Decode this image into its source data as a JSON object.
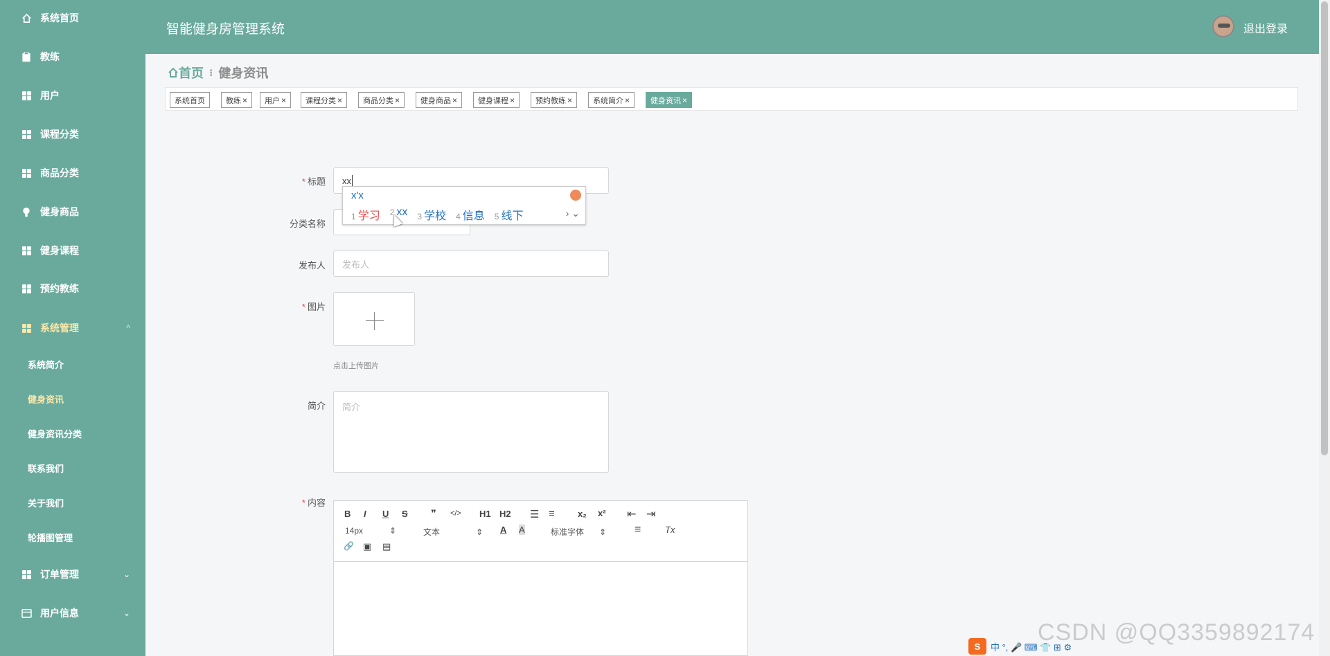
{
  "sidebar": {
    "items": [
      {
        "label": "系统首页",
        "icon": "home-icon"
      },
      {
        "label": "教练",
        "icon": "clipboard-icon"
      },
      {
        "label": "用户",
        "icon": "grid-icon"
      },
      {
        "label": "课程分类",
        "icon": "grid-icon"
      },
      {
        "label": "商品分类",
        "icon": "grid-icon"
      },
      {
        "label": "健身商品",
        "icon": "bulb-icon"
      },
      {
        "label": "健身课程",
        "icon": "grid-icon"
      },
      {
        "label": "预约教练",
        "icon": "grid-icon"
      },
      {
        "label": "系统管理",
        "icon": "grid-icon"
      },
      {
        "label": "订单管理",
        "icon": "grid-icon"
      },
      {
        "label": "用户信息",
        "icon": "card-icon"
      }
    ],
    "sub_items": [
      "系统简介",
      "健身资讯",
      "健身资讯分类",
      "联系我们",
      "关于我们",
      "轮播图管理"
    ],
    "active_sub": "健身资讯",
    "chevron_up": "^",
    "chevron_down": "⌄"
  },
  "header": {
    "title": "智能健身房管理系统",
    "logout": "退出登录"
  },
  "breadcrumb": {
    "home": "首页",
    "separator": "⁝",
    "current": "健身资讯"
  },
  "tabs": [
    {
      "label": "系统首页",
      "closable": false
    },
    {
      "label": "教练",
      "closable": true
    },
    {
      "label": "用户",
      "closable": true
    },
    {
      "label": "课程分类",
      "closable": true
    },
    {
      "label": "商品分类",
      "closable": true
    },
    {
      "label": "健身商品",
      "closable": true
    },
    {
      "label": "健身课程",
      "closable": true
    },
    {
      "label": "预约教练",
      "closable": true
    },
    {
      "label": "系统简介",
      "closable": true
    },
    {
      "label": "健身资讯",
      "closable": true,
      "active": true
    }
  ],
  "tab_close": "×",
  "form": {
    "title_label": "标题",
    "title_value": "xx",
    "category_label": "分类名称",
    "publisher_label": "发布人",
    "publisher_placeholder": "发布人",
    "image_label": "图片",
    "upload_hint": "点击上传图片",
    "intro_label": "简介",
    "intro_placeholder": "简介",
    "content_label": "内容",
    "required_mark": "*"
  },
  "editor": {
    "bold": "B",
    "italic": "I",
    "underline": "U",
    "strike": "S",
    "quote": "❞",
    "code": "</>",
    "h1": "H1",
    "h2": "H2",
    "ordered_list": "☰",
    "bullet_list": "≡",
    "subscript": "x₂",
    "superscript": "x²",
    "outdent": "⇤",
    "indent": "⇥",
    "font_size": "14px",
    "text_style": "文本",
    "font_family": "标准字体",
    "font_color": "A",
    "bg_color": "A",
    "align": "≡",
    "clear": "Tx",
    "link": "🔗",
    "image": "▣",
    "video": "▤"
  },
  "ime": {
    "composition": "x'x",
    "candidates": [
      {
        "num": "1",
        "text": "学习"
      },
      {
        "num": "2",
        "text": "xx"
      },
      {
        "num": "3",
        "text": "学校"
      },
      {
        "num": "4",
        "text": "信息"
      },
      {
        "num": "5",
        "text": "线下"
      }
    ],
    "nav": "› ⌄"
  },
  "tray": {
    "logo": "S",
    "items": "中 °, 🎤 ⌨ 👕 ⊞ ⚙"
  },
  "watermark": "CSDN @QQ3359892174",
  "colors": {
    "primary": "#6aaa9d",
    "active_sub": "#fde7a7",
    "required": "#e94b4b"
  }
}
